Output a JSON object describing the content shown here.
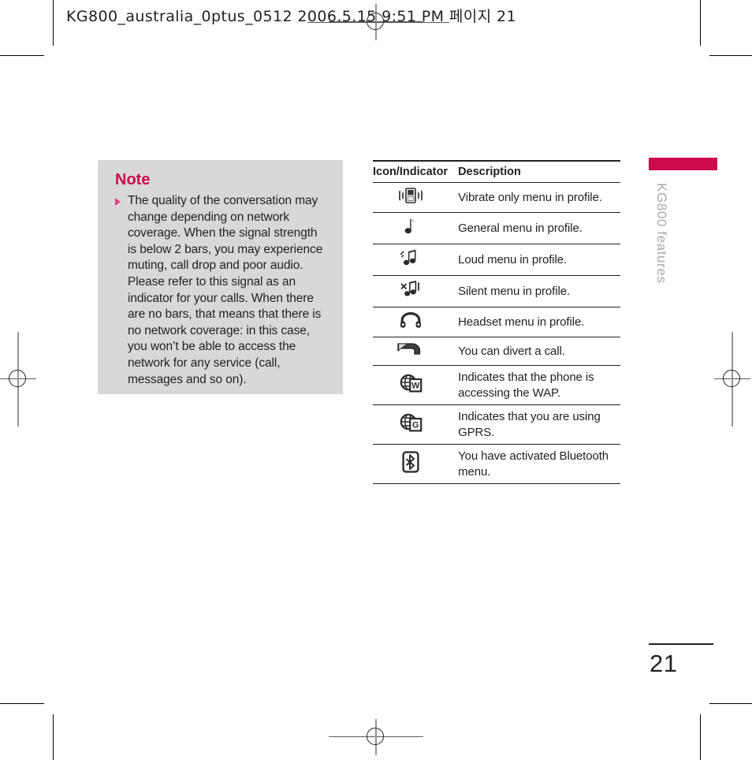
{
  "print_slug": {
    "text": "KG800_australia_0ptus_0512  2006.5.15 9:51 PM  페이지 21"
  },
  "note": {
    "title": "Note",
    "body": "The quality of the conversation may change depending on network coverage. When the signal strength is below 2 bars, you may experience muting, call drop and poor audio. Please refer to this signal as an indicator for your calls. When there are no bars, that means that there is no network coverage: in this case, you won’t be able to access the network for any service (call, messages and so on)."
  },
  "icon_table": {
    "headers": {
      "icon": "Icon/Indicator",
      "description": "Description"
    },
    "rows": [
      {
        "icon_name": "vibrate-only-icon",
        "description": "Vibrate only menu in profile."
      },
      {
        "icon_name": "general-profile-note-icon",
        "description": "General menu in profile."
      },
      {
        "icon_name": "loud-profile-notes-icon",
        "description": "Loud menu in profile."
      },
      {
        "icon_name": "silent-profile-icon",
        "description": "Silent menu in profile."
      },
      {
        "icon_name": "headset-icon",
        "description": "Headset menu in profile."
      },
      {
        "icon_name": "call-divert-icon",
        "description": "You can divert a call."
      },
      {
        "icon_name": "wap-globe-icon",
        "description": "Indicates that the phone is accessing the WAP."
      },
      {
        "icon_name": "gprs-globe-icon",
        "description": "Indicates that you are using GPRS."
      },
      {
        "icon_name": "bluetooth-icon",
        "description": "You have activated Bluetooth menu."
      }
    ]
  },
  "side_tab": {
    "label": "KG800 features"
  },
  "folio": {
    "page_number": "21"
  },
  "colors": {
    "accent_crimson": "#cc0b4c",
    "bullet_pink": "#e5417e",
    "note_panel_gray": "#d8d8d8",
    "side_title_gray": "#a7a9ac",
    "ink": "#231f20"
  }
}
